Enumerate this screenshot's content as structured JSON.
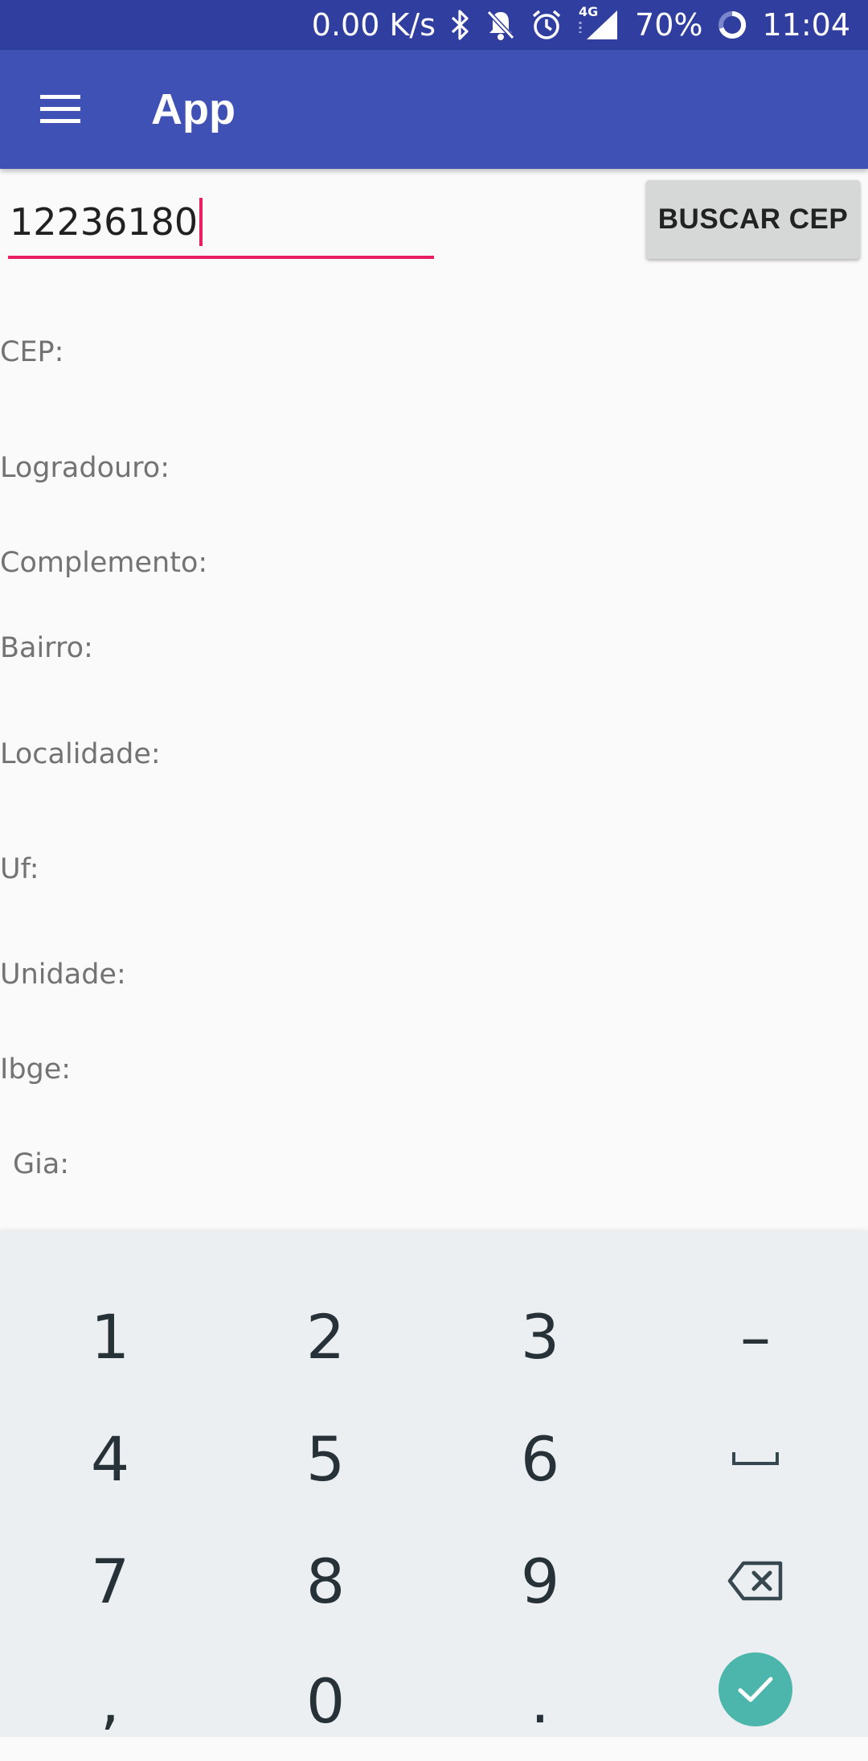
{
  "status_bar": {
    "network_speed": "0.00 K/s",
    "network_type": "4G",
    "battery": "70%",
    "clock": "11:04",
    "icons": [
      "bluetooth-icon",
      "notifications-off-icon",
      "alarm-icon",
      "signal-icon",
      "battery-saver-icon"
    ]
  },
  "app_bar": {
    "title": "App",
    "menu_icon": "menu-icon"
  },
  "form": {
    "cep_value": "12236180",
    "search_button": "BUSCAR CEP",
    "accent_color": "#e91e63"
  },
  "fields": {
    "cep": "CEP:",
    "logradouro": "Logradouro:",
    "complemento": "Complemento:",
    "bairro": "Bairro:",
    "localidade": "Localidade:",
    "uf": "Uf:",
    "unidade": "Unidade:",
    "ibge": "Ibge:",
    "gia": "Gia:"
  },
  "keyboard": {
    "keys": {
      "k1": "1",
      "k2": "2",
      "k3": "3",
      "dash": "–",
      "k4": "4",
      "k5": "5",
      "k6": "6",
      "k7": "7",
      "k8": "8",
      "k9": "9",
      "comma": ",",
      "k0": "0",
      "period": "."
    },
    "special_icons": [
      "space-icon",
      "backspace-icon",
      "done-check-icon"
    ],
    "enter_color": "#4db6ac"
  },
  "colors": {
    "status_bar": "#303f9f",
    "app_bar": "#3f51b5",
    "button": "#d6d7d7",
    "keyboard_bg": "#eceff1"
  }
}
